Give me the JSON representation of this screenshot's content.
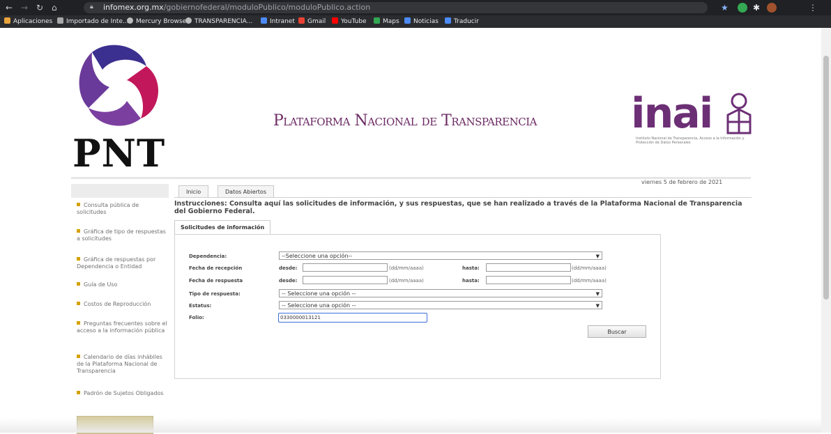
{
  "browser": {
    "url_domain": "infomex.org.mx",
    "url_path": "/gobiernofederal/moduloPublico/moduloPublico.action",
    "bookmarks": [
      {
        "label": "Aplicaciones",
        "icon": "apps-grid-icon",
        "color": "#e8a33d"
      },
      {
        "label": "Importado de Inte...",
        "icon": "folder-icon",
        "color": "#a8a8a8"
      },
      {
        "label": "Mercury Browser",
        "icon": "globe-icon",
        "color": "#bdbdbd"
      },
      {
        "label": "TRANSPARENCIA...",
        "icon": "globe-icon",
        "color": "#bdbdbd"
      },
      {
        "label": "Intranet",
        "icon": "intranet-icon",
        "color": "#4c8bf5"
      },
      {
        "label": "Gmail",
        "icon": "gmail-icon",
        "color": "#e94235"
      },
      {
        "label": "YouTube",
        "icon": "youtube-icon",
        "color": "#ff0000"
      },
      {
        "label": "Maps",
        "icon": "maps-icon",
        "color": "#34a853"
      },
      {
        "label": "Noticias",
        "icon": "news-icon",
        "color": "#4c8bf5"
      },
      {
        "label": "Traducir",
        "icon": "translate-icon",
        "color": "#4c8bf5"
      }
    ]
  },
  "header": {
    "pnt_logo_text": "PNT",
    "title": "Plataforma Nacional de Transparencia",
    "inai_logo_text": "inai",
    "inai_subtitle": "Instituto Nacional de Transparencia, Acceso a la Información y Protección de Datos Personales",
    "date": "viernes 5 de febrero de 2021"
  },
  "sidebar": {
    "items": [
      "Consulta pública de solicitudes",
      "Gráfica de tipo de respuestas a solicitudes",
      "Gráfica de respuestas por Dependencia o Entidad",
      "Guía de Uso",
      "Costos de Reproducción",
      "Preguntas frecuentes sobre el acceso a la información pública",
      "Calendario de días inhábiles de la Plataforma Nacional de Transparencia",
      "Padrón de Sujetos Obligados"
    ]
  },
  "tabs": [
    "Inicio",
    "Datos Abiertos"
  ],
  "instructions": "Instrucciones: Consulta aquí las solicitudes de información, y sus respuestas, que se han realizado a través de la Plataforma Nacional de Transparencia del Gobierno Federal.",
  "form": {
    "tab_label": "Solicitudes de información",
    "dependencia_label": "Dependencia:",
    "dependencia_value": "--Seleccione una opción--",
    "fecha_recepcion_label": "Fecha de recepción",
    "fecha_respuesta_label": "Fecha de respuesta",
    "desde_label": "desde:",
    "hasta_label": "hasta:",
    "date_format": "(dd/mm/aaaa)",
    "tipo_respuesta_label": "Tipo de respuesta:",
    "tipo_respuesta_value": "-- Seleccione una opción --",
    "estatus_label": "Estatus:",
    "estatus_value": "-- Seleccione una opción --",
    "folio_label": "Folio:",
    "folio_value": "0330000013121",
    "buscar_label": "Buscar"
  }
}
